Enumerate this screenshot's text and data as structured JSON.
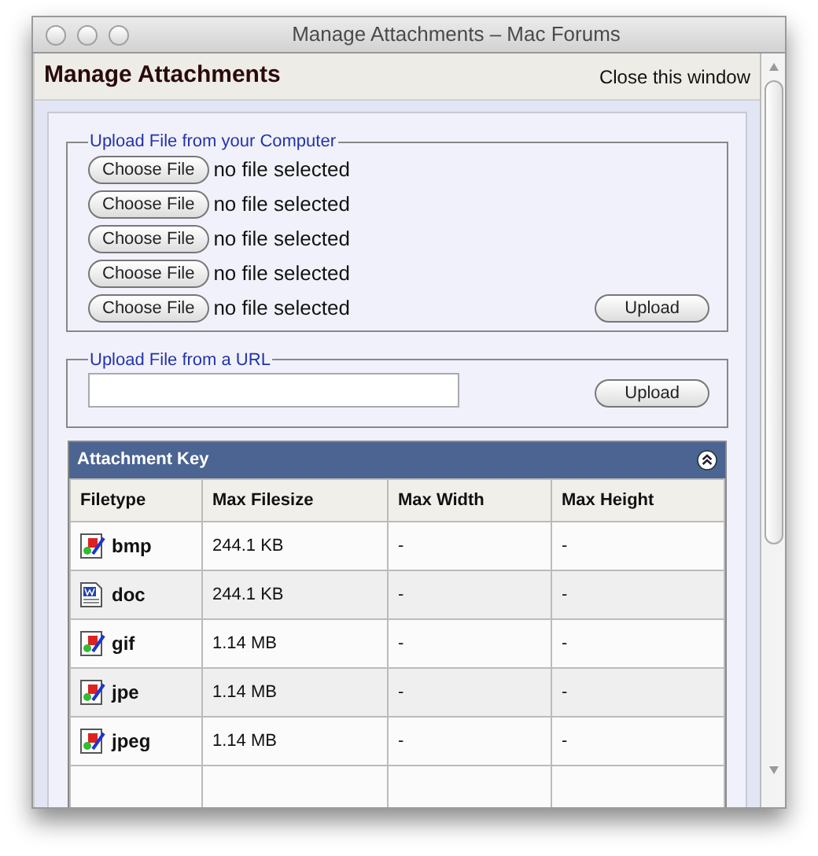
{
  "window": {
    "title": "Manage Attachments – Mac Forums"
  },
  "header": {
    "title": "Manage Attachments",
    "close_link": "Close this window"
  },
  "computer_upload": {
    "legend": "Upload File from your Computer",
    "files": [
      {
        "button": "Choose File",
        "status": "no file selected"
      },
      {
        "button": "Choose File",
        "status": "no file selected"
      },
      {
        "button": "Choose File",
        "status": "no file selected"
      },
      {
        "button": "Choose File",
        "status": "no file selected"
      },
      {
        "button": "Choose File",
        "status": "no file selected"
      }
    ],
    "upload_button": "Upload"
  },
  "url_upload": {
    "legend": "Upload File from a URL",
    "upload_button": "Upload"
  },
  "attachment_key": {
    "title": "Attachment Key",
    "columns": [
      "Filetype",
      "Max Filesize",
      "Max Width",
      "Max Height"
    ],
    "rows": [
      {
        "kind": "image",
        "filetype": "bmp",
        "max_filesize": "244.1 KB",
        "max_width": "-",
        "max_height": "-"
      },
      {
        "kind": "document",
        "filetype": "doc",
        "max_filesize": "244.1 KB",
        "max_width": "-",
        "max_height": "-"
      },
      {
        "kind": "image",
        "filetype": "gif",
        "max_filesize": "1.14 MB",
        "max_width": "-",
        "max_height": "-"
      },
      {
        "kind": "image",
        "filetype": "jpe",
        "max_filesize": "1.14 MB",
        "max_width": "-",
        "max_height": "-"
      },
      {
        "kind": "image",
        "filetype": "jpeg",
        "max_filesize": "1.14 MB",
        "max_width": "-",
        "max_height": "-"
      }
    ]
  }
}
